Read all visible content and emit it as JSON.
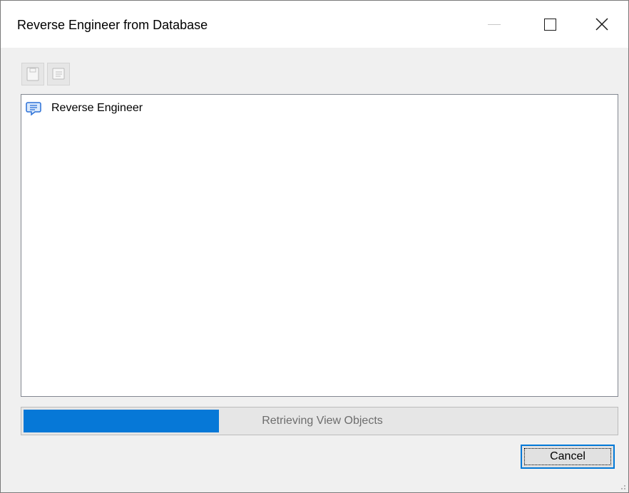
{
  "window": {
    "title": "Reverse Engineer from Database"
  },
  "titlebar": {
    "minimize": "minimize-icon",
    "maximize": "maximize-icon",
    "close": "close-icon"
  },
  "toolbar": {
    "buttons": [
      "save-icon",
      "properties-icon"
    ]
  },
  "tree": {
    "items": [
      {
        "label": "Reverse Engineer",
        "icon": "message-icon"
      }
    ]
  },
  "progress": {
    "status": "Retrieving View Objects",
    "fraction": 0.33
  },
  "buttons": {
    "cancel_label": "Cancel"
  },
  "colors": {
    "progress_fill": "#0678d7",
    "focus_border": "#0078d7",
    "dialog_bg": "#f0f0f0"
  }
}
